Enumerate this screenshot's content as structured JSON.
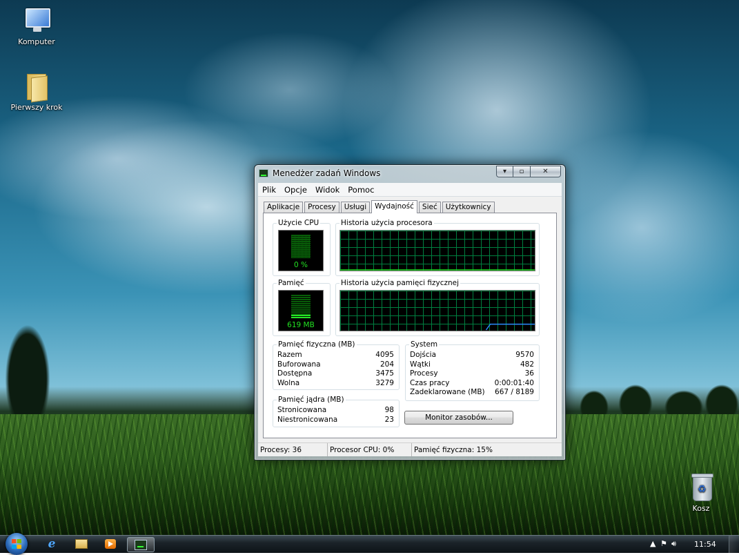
{
  "desktop": {
    "icons": [
      {
        "label": "Komputer",
        "icon": "computer-icon"
      },
      {
        "label": "Pierwszy krok",
        "icon": "folder-icon"
      },
      {
        "label": "Kosz",
        "icon": "recycle-bin-icon"
      }
    ]
  },
  "window": {
    "title": "Menedżer zadań Windows",
    "buttons": {
      "minimize": "▾",
      "maximize": "▫",
      "close": "✕"
    },
    "menu": [
      "Plik",
      "Opcje",
      "Widok",
      "Pomoc"
    ],
    "tabs": [
      "Aplikacje",
      "Procesy",
      "Usługi",
      "Wydajność",
      "Sieć",
      "Użytkownicy"
    ],
    "active_tab": "Wydajność",
    "cpu": {
      "label": "Użycie CPU",
      "value": "0 %",
      "level": 0
    },
    "cpu_history": {
      "label": "Historia użycia procesora"
    },
    "memory": {
      "label": "Pamięć",
      "value": "619 MB",
      "level": 0.15
    },
    "memory_history": {
      "label": "Historia użycia pamięci fizycznej"
    },
    "physical_memory": {
      "label": "Pamięć fizyczna (MB)",
      "rows": [
        {
          "name": "Razem",
          "value": "4095"
        },
        {
          "name": "Buforowana",
          "value": "204"
        },
        {
          "name": "Dostępna",
          "value": "3475"
        },
        {
          "name": "Wolna",
          "value": "3279"
        }
      ]
    },
    "kernel_memory": {
      "label": "Pamięć jądra (MB)",
      "rows": [
        {
          "name": "Stronicowana",
          "value": "98"
        },
        {
          "name": "Niestronicowana",
          "value": "23"
        }
      ]
    },
    "system": {
      "label": "System",
      "rows": [
        {
          "name": "Dojścia",
          "value": "9570"
        },
        {
          "name": "Wątki",
          "value": "482"
        },
        {
          "name": "Procesy",
          "value": "36"
        },
        {
          "name": "Czas pracy",
          "value": "0:00:01:40"
        },
        {
          "name": "Zadeklarowane (MB)",
          "value": "667 / 8189"
        }
      ]
    },
    "resource_monitor_button": "Monitor zasobów...",
    "status": {
      "processes": "Procesy: 36",
      "cpu": "Procesor CPU: 0%",
      "memory": "Pamięć fizyczna: 15%"
    },
    "colors": {
      "graph_grid": "#008040",
      "cpu_line": "#22e022",
      "memory_line": "#2a8cff",
      "meter_green": "#25e825"
    }
  },
  "taskbar": {
    "apps": [
      {
        "name": "ie",
        "icon": "internet-explorer-icon",
        "glyph": "e"
      },
      {
        "name": "explorer",
        "icon": "folder-icon"
      },
      {
        "name": "media-player",
        "icon": "media-player-icon"
      },
      {
        "name": "task-manager",
        "icon": "task-manager-icon",
        "active": true
      }
    ],
    "tray": {
      "flag_icon": "action-center-flag-icon",
      "network_icon": "network-icon",
      "volume_icon": "volume-icon"
    },
    "clock": "11:54"
  }
}
